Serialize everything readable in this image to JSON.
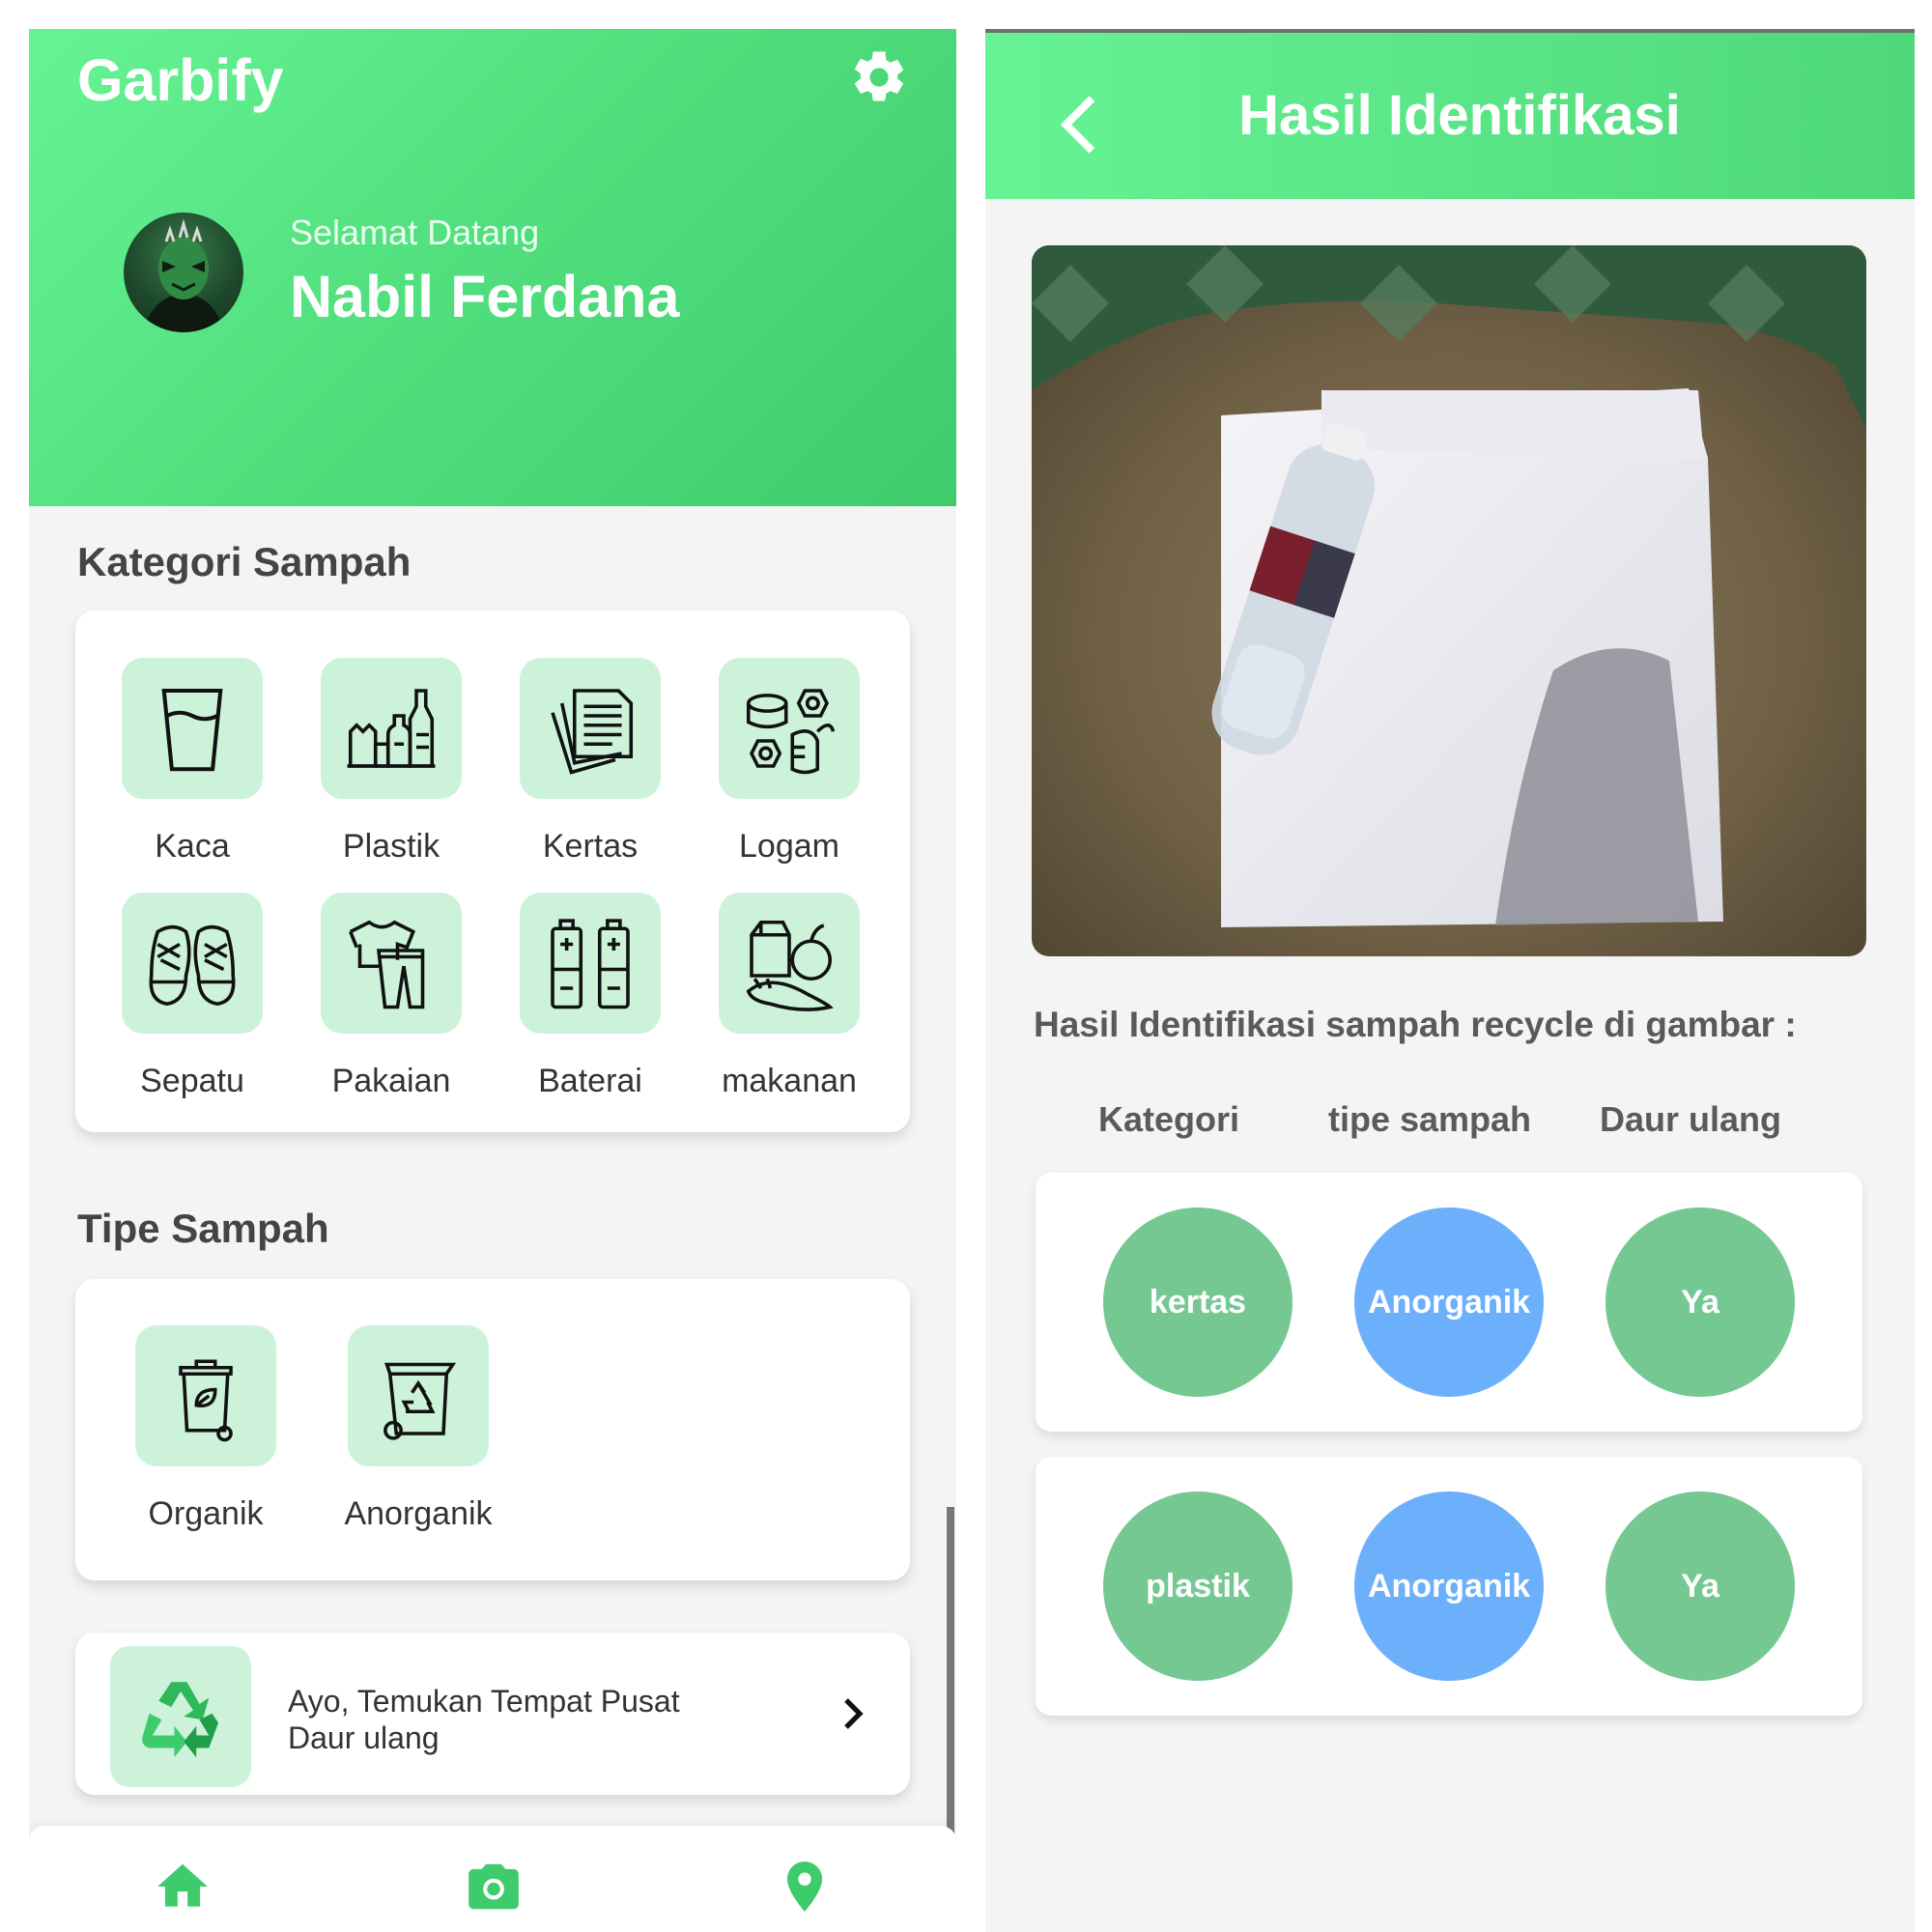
{
  "home": {
    "app_title": "Garbify",
    "welcome": "Selamat Datang",
    "user_name": "Nabil Ferdana",
    "categories_title": "Kategori Sampah",
    "categories": [
      "Kaca",
      "Plastik",
      "Kertas",
      "Logam",
      "Sepatu",
      "Pakaian",
      "Baterai",
      "makanan"
    ],
    "types_title": "Tipe Sampah",
    "types": [
      "Organik",
      "Anorganik"
    ],
    "cta_line1": "Ayo, Temukan Tempat Pusat",
    "cta_line2": "Daur ulang",
    "nav": [
      "home-icon",
      "camera-icon",
      "location-pin-icon"
    ]
  },
  "result": {
    "title": "Hasil Identifikasi",
    "caption": "Hasil Identifikasi sampah recycle di gambar :",
    "headers": [
      "Kategori",
      "tipe sampah",
      "Daur ulang"
    ],
    "rows": [
      {
        "category": "kertas",
        "type": "Anorganik",
        "recycle": "Ya"
      },
      {
        "category": "plastik",
        "type": "Anorganik",
        "recycle": "Ya"
      }
    ]
  },
  "colors": {
    "brand_green": "#52e07f",
    "tile_green": "#cdf2da",
    "bubble_green": "#76c893",
    "bubble_blue": "#6cb0fc",
    "nav_green": "#3ecb6c"
  }
}
